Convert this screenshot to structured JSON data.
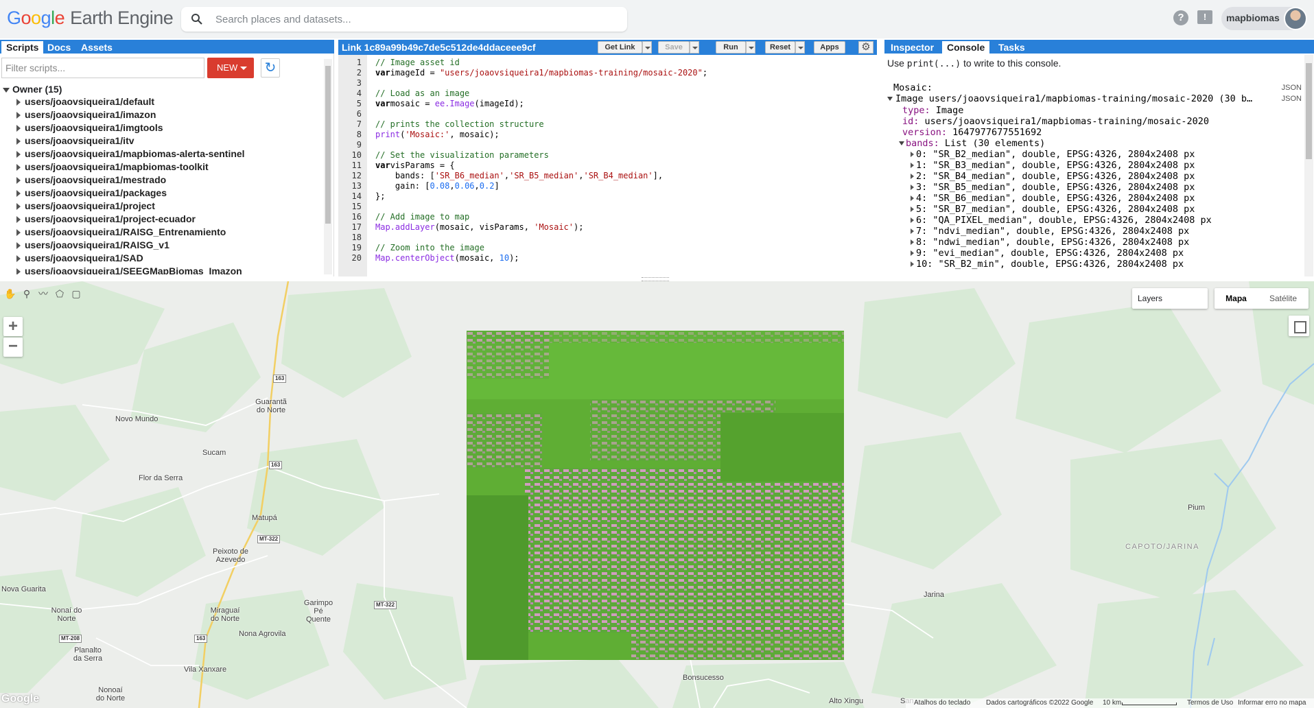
{
  "header": {
    "logo_google": [
      "G",
      "o",
      "o",
      "g",
      "l",
      "e"
    ],
    "logo_product": "Earth Engine",
    "search_placeholder": "Search places and datasets...",
    "help_label": "?",
    "feedback_label": "!",
    "account_name": "mapbiomas"
  },
  "left_panel": {
    "tabs": [
      "Scripts",
      "Docs",
      "Assets"
    ],
    "filter_placeholder": "Filter scripts...",
    "new_label": "NEW",
    "refresh_label": "↻",
    "owner_label": "Owner (15)",
    "repos": [
      "users/joaovsiqueira1/default",
      "users/joaovsiqueira1/imazon",
      "users/joaovsiqueira1/imgtools",
      "users/joaovsiqueira1/itv",
      "users/joaovsiqueira1/mapbiomas-alerta-sentinel",
      "users/joaovsiqueira1/mapbiomas-toolkit",
      "users/joaovsiqueira1/mestrado",
      "users/joaovsiqueira1/packages",
      "users/joaovsiqueira1/project",
      "users/joaovsiqueira1/project-ecuador",
      "users/joaovsiqueira1/RAISG_Entrenamiento",
      "users/joaovsiqueira1/RAISG_v1",
      "users/joaovsiqueira1/SAD",
      "users/joaovsiqueira1/SEEGMapBiomas_Imazon"
    ]
  },
  "editor": {
    "title": "Link 1c89a99b49c7de5c512de4ddaceee9cf",
    "buttons": {
      "get_link": "Get Link",
      "save": "Save",
      "run": "Run",
      "reset": "Reset",
      "apps": "Apps"
    },
    "line_numbers": [
      "1",
      "2",
      "3",
      "4",
      "5",
      "6",
      "7",
      "8",
      "9",
      "10",
      "11",
      "12",
      "13",
      "14",
      "15",
      "16",
      "17",
      "18",
      "19",
      "20"
    ],
    "lines": [
      [
        [
          "cm",
          "// Image asset id"
        ]
      ],
      [
        [
          "kw",
          "var"
        ],
        [
          "",
          "imageId = "
        ],
        [
          "str",
          "\"users/joaovsiqueira1/mapbiomas-training/mosaic-2020\""
        ],
        [
          "",
          ";"
        ]
      ],
      [],
      [
        [
          "cm",
          "// Load as an image"
        ]
      ],
      [
        [
          "kw",
          "var"
        ],
        [
          "",
          "mosaic = "
        ],
        [
          "fn",
          "ee.Image"
        ],
        [
          "",
          "(imageId);"
        ]
      ],
      [],
      [
        [
          "cm",
          "// prints the collection structure"
        ]
      ],
      [
        [
          "fn",
          "print"
        ],
        [
          "",
          "("
        ],
        [
          "str",
          "'Mosaic:'"
        ],
        [
          "",
          ", mosaic);"
        ]
      ],
      [],
      [
        [
          "cm",
          "// Set the visualization parameters"
        ]
      ],
      [
        [
          "kw",
          "var"
        ],
        [
          "",
          "visParams = {"
        ]
      ],
      [
        [
          "",
          "    bands: ["
        ],
        [
          "str",
          "'SR_B6_median'"
        ],
        [
          "",
          ","
        ],
        [
          "str",
          "'SR_B5_median'"
        ],
        [
          "",
          ","
        ],
        [
          "str",
          "'SR_B4_median'"
        ],
        [
          "",
          "],"
        ]
      ],
      [
        [
          "",
          "    gain: ["
        ],
        [
          "num",
          "0.08"
        ],
        [
          "",
          ","
        ],
        [
          "num",
          "0.06"
        ],
        [
          "",
          ","
        ],
        [
          "num",
          "0.2"
        ],
        [
          "",
          "]"
        ]
      ],
      [
        [
          "",
          "};"
        ]
      ],
      [],
      [
        [
          "cm",
          "// Add image to map"
        ]
      ],
      [
        [
          "fn",
          "Map.addLayer"
        ],
        [
          "",
          "(mosaic, visParams, "
        ],
        [
          "str",
          "'Mosaic'"
        ],
        [
          "",
          ");"
        ]
      ],
      [],
      [
        [
          "cm",
          "// Zoom into the image"
        ]
      ],
      [
        [
          "fn",
          "Map.centerObject"
        ],
        [
          "",
          "(mosaic, "
        ],
        [
          "num",
          "10"
        ],
        [
          "",
          ");"
        ]
      ]
    ]
  },
  "right_panel": {
    "tabs": [
      "Inspector",
      "Console",
      "Tasks"
    ],
    "hint_prefix": "Use ",
    "hint_code": "print(...)",
    "hint_suffix": " to write to this console.",
    "json_label": "JSON",
    "mosaic_label": "Mosaic:",
    "image_line": "Image users/joaovsiqueira1/mapbiomas-training/mosaic-2020 (30 b…",
    "type_key": "type:",
    "type_val": " Image",
    "id_key": "id:",
    "id_val": " users/joaovsiqueira1/mapbiomas-training/mosaic-2020",
    "version_key": "version:",
    "version_val": " 1647977677551692",
    "bands_key": "bands:",
    "bands_val": " List (30 elements)",
    "bands": [
      "0: \"SR_B2_median\", double, EPSG:4326, 2804x2408 px",
      "1: \"SR_B3_median\", double, EPSG:4326, 2804x2408 px",
      "2: \"SR_B4_median\", double, EPSG:4326, 2804x2408 px",
      "3: \"SR_B5_median\", double, EPSG:4326, 2804x2408 px",
      "4: \"SR_B6_median\", double, EPSG:4326, 2804x2408 px",
      "5: \"SR_B7_median\", double, EPSG:4326, 2804x2408 px",
      "6: \"QA_PIXEL_median\", double, EPSG:4326, 2804x2408 px",
      "7: \"ndvi_median\", double, EPSG:4326, 2804x2408 px",
      "8: \"ndwi_median\", double, EPSG:4326, 2804x2408 px",
      "9: \"evi_median\", double, EPSG:4326, 2804x2408 px",
      "10: \"SR_B2_min\", double, EPSG:4326, 2804x2408 px"
    ]
  },
  "map": {
    "layers_label": "Layers",
    "maptype_map": "Mapa",
    "maptype_satellite": "Satélite",
    "zoom_in": "+",
    "zoom_out": "−",
    "google_label": "Google",
    "places": [
      "Guarantã do Norte",
      "Novo Mundo",
      "Sucam",
      "Flor da Serra",
      "Matupá",
      "Peixoto de Azevedo",
      "Nova Guarita",
      "Nonaí do Norte",
      "Miraguaí do Norte",
      "Garimpo Pé Quente",
      "Nona Agrovila",
      "Planalto da Serra",
      "Vila Xanxare",
      "Nonoaí do Norte",
      "Bonsucesso",
      "Alto Xingu",
      "Jarina",
      "Pium",
      "CAPOTO/JARINA",
      "San"
    ],
    "shields": [
      "163",
      "163",
      "MT-322",
      "MT-322",
      "MT-208",
      "163"
    ],
    "attribution": {
      "shortcuts": "Atalhos do teclado",
      "data": "Dados cartográficos ©2022 Google",
      "scale": "10 km",
      "terms": "Termos de Uso",
      "report": "Informar erro no mapa"
    }
  }
}
